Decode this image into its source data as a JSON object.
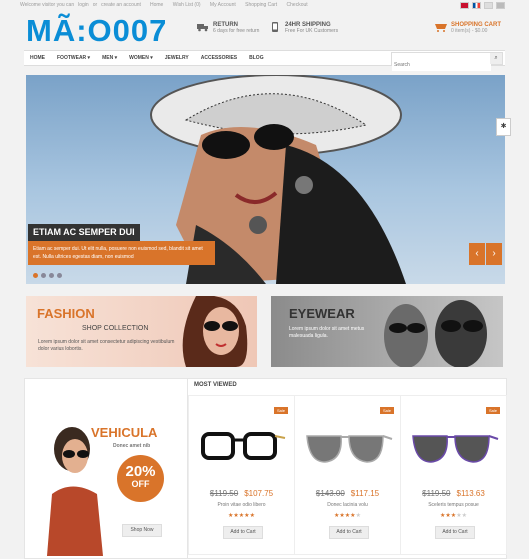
{
  "topbar": {
    "welcome": "Welcome visitor you can",
    "login": "login",
    "or": "or",
    "create": "create an account",
    "links": [
      "Home",
      "Wish List (0)",
      "My Account",
      "Shopping Cart",
      "Checkout"
    ]
  },
  "header": {
    "logo": "MÃ:O007",
    "return_title": "RETURN",
    "return_text": "6 days for free return",
    "shipping_title": "24HR SHIPPING",
    "shipping_text": "Free For UK Customers",
    "cart_title": "SHOPPING CART",
    "cart_text": "0 item(s) - $0.00"
  },
  "nav": {
    "items": [
      "HOME",
      "FOOTWEAR",
      "MEN",
      "WOMEN",
      "JEWELRY",
      "ACCESSORIES",
      "BLOG"
    ],
    "search_placeholder": "Search"
  },
  "slider": {
    "title": "ETIAM AC SEMPER DUI",
    "text": "Etiam ac semper dui. Ut elit nulla, posuere non euismod sed, blandit sit amet est. Nulla ultrices egestas diam, non euismod",
    "prev_icon": "chevron-left-icon",
    "next_icon": "chevron-right-icon",
    "dots": 4,
    "active_dot": 0
  },
  "banners": {
    "fashion_title": "FASHION",
    "fashion_sub": "SHOP COLLECTION",
    "fashion_text": "Lorem ipsum dolor sit amet consectetur adipiscing vestibulum dolor varius lobortis.",
    "eyewear_title": "EYEWEAR",
    "eyewear_text": "Lorem ipsum dolor sit amet metus malesuada ligula."
  },
  "promo": {
    "title": "VEHICULA",
    "sub": "Donec amet nib",
    "percent": "20%",
    "off": "OFF",
    "button": "Shop Now"
  },
  "most_viewed": {
    "heading": "MOST VIEWED",
    "products": [
      {
        "sale": "Sale",
        "old_price": "$119.50",
        "price": "$107.75",
        "name": "Proin vitae odio libero",
        "rating": 5,
        "button": "Add to Cart"
      },
      {
        "sale": "Sale",
        "old_price": "$143.00",
        "price": "$117.15",
        "name": "Donec lacinia volu",
        "rating": 4,
        "button": "Add to Cart"
      },
      {
        "sale": "Sale",
        "old_price": "$119.50",
        "price": "$113.63",
        "name": "Sceleris tempus posue",
        "rating": 3,
        "button": "Add to Cart"
      }
    ]
  },
  "colors": {
    "accent": "#d9742a",
    "logo": "#0a8dd6"
  }
}
